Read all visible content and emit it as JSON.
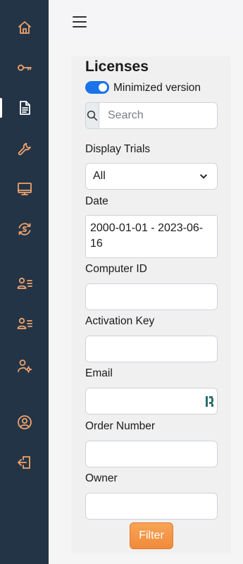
{
  "sidebar": {
    "items": [
      {
        "name": "home-icon",
        "active": false
      },
      {
        "name": "key-icon",
        "active": false
      },
      {
        "name": "document-icon",
        "active": true
      },
      {
        "name": "wrench-icon",
        "active": false
      },
      {
        "name": "monitor-icon",
        "active": false
      },
      {
        "name": "subscription-cycle-icon",
        "active": false
      },
      {
        "name": "user-list-icon",
        "active": false
      },
      {
        "name": "user-list-icon",
        "active": false
      },
      {
        "name": "user-settings-icon",
        "active": false
      },
      {
        "name": "account-circle-icon",
        "active": false
      },
      {
        "name": "logout-icon",
        "active": false
      }
    ],
    "accent_color": "#f1a36a",
    "background_color": "#243447"
  },
  "topbar": {
    "menu_icon": "hamburger-icon"
  },
  "page": {
    "title": "Licenses",
    "minimized_toggle": {
      "label": "Minimized version",
      "on": true
    }
  },
  "search": {
    "placeholder": "Search",
    "value": "",
    "icon": "search-icon"
  },
  "filters": {
    "display_trials": {
      "label": "Display Trials",
      "value": "All"
    },
    "date": {
      "label": "Date",
      "value": "2000-01-01 - 2023-06-16"
    },
    "computer_id": {
      "label": "Computer ID",
      "value": ""
    },
    "activation_key": {
      "label": "Activation Key",
      "value": ""
    },
    "email": {
      "label": "Email",
      "value": ""
    },
    "order_number": {
      "label": "Order Number",
      "value": ""
    },
    "owner": {
      "label": "Owner",
      "value": ""
    }
  },
  "filter_button": {
    "label": "Filter",
    "color": "#f39343"
  }
}
